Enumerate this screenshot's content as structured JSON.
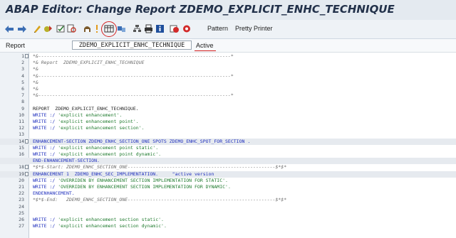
{
  "window": {
    "title": "ABAP Editor: Change Report ZDEMO_EXPLICIT_ENHC_TECHNIQUE"
  },
  "toolbar": {
    "icons": [
      "back-arrow-icon",
      "forward-arrow-icon",
      "display-change-icon",
      "activate-icon",
      "check-icon",
      "where-used-icon",
      "navigation-icon",
      "enhance-icon",
      "object-list-icon",
      "navigation-window-icon",
      "hierarchy-icon",
      "print-icon",
      "info-icon",
      "breakpoint-icon",
      "external-breakpoint-icon"
    ],
    "pattern_label": "Pattern",
    "pretty_printer_label": "Pretty Printer"
  },
  "report_bar": {
    "label": "Report",
    "name": "ZDEMO_EXPLICIT_ENHC_TECHNIQUE",
    "status": "Active"
  },
  "editor": {
    "lines": [
      {
        "n": "1",
        "text": "*&---------------------------------------------------------------------*",
        "kind": "comment"
      },
      {
        "n": "2",
        "text": "*& Report  ZDEMO_EXPLICIT_ENHC_TECHNIQUE",
        "kind": "comment"
      },
      {
        "n": "3",
        "text": "*&",
        "kind": "comment"
      },
      {
        "n": "4",
        "text": "*&---------------------------------------------------------------------*",
        "kind": "comment"
      },
      {
        "n": "5",
        "text": "*&",
        "kind": "comment"
      },
      {
        "n": "6",
        "text": "*&",
        "kind": "comment"
      },
      {
        "n": "7",
        "text": "*&---------------------------------------------------------------------*",
        "kind": "comment"
      },
      {
        "n": "8",
        "text": "",
        "kind": "plain"
      },
      {
        "n": "9",
        "text": "REPORT  ZDEMO_EXPLICIT_ENHC_TECHNIQUE.",
        "kind": "plain"
      },
      {
        "n": "10",
        "text": "WRITE :/ 'explicit enhancement'.",
        "kind": "plain"
      },
      {
        "n": "11",
        "text": "WRITE :/ 'explicit enhancement point'.",
        "kind": "plain"
      },
      {
        "n": "12",
        "text": "WRITE :/ 'explicit enhancement section'.",
        "kind": "plain"
      },
      {
        "n": "13",
        "text": "",
        "kind": "plain"
      },
      {
        "n": "14",
        "text": "ENHANCEMENT-SECTION ZDEMO_ENHC_SECTION_ONE SPOTS ZDEMO_ENHC_SPOT_FOR_SECTION .",
        "kind": "kw"
      },
      {
        "n": "15",
        "text": "WRITE :/ 'explicit enhancement point static'.",
        "kind": "plain"
      },
      {
        "n": "16",
        "text": "WRITE :/ 'explicit enhancement point dynamic'.",
        "kind": "plain"
      },
      {
        "n": "",
        "text": "END-ENHANCEMENT-SECTION.",
        "kind": "kw"
      },
      {
        "n": "18",
        "text": "*$*$-Start: ZDEMO_ENHC_SECTION_ONE-----------------------------------------------------$*$*",
        "kind": "comment"
      },
      {
        "n": "19",
        "text": "ENHANCEMENT 1  ZDEMO_ENHC_SEC_IMPLEMENTATION.     \"active version",
        "kind": "kw"
      },
      {
        "n": "20",
        "text": "WRITE :/ 'OVERRIDEN BY ENHANCEMENT SECTION IMPLEMENTATION FOR STATIC'.",
        "kind": "plain"
      },
      {
        "n": "21",
        "text": "WRITE :/ 'OVERRIDEN BY ENHANCEMENT SECTION IMPLEMENTATION FOR DYNAMIC'.",
        "kind": "plain"
      },
      {
        "n": "22",
        "text": "ENDENHANCEMENT.",
        "kind": "kw"
      },
      {
        "n": "23",
        "text": "*$*$-End:   ZDEMO_ENHC_SECTION_ONE-----------------------------------------------------$*$*",
        "kind": "comment"
      },
      {
        "n": "24",
        "text": "",
        "kind": "plain"
      },
      {
        "n": "25",
        "text": "",
        "kind": "plain"
      },
      {
        "n": "26",
        "text": "WRITE :/ 'explicit enhancement section static'.",
        "kind": "plain"
      },
      {
        "n": "27",
        "text": "WRITE :/ 'explicit enhancement section dynamic'.",
        "kind": "plain"
      }
    ]
  },
  "colors": {
    "accent_red": "#d4201f",
    "keyword_blue": "#1f2fbd",
    "string_green": "#1e7a2d"
  }
}
